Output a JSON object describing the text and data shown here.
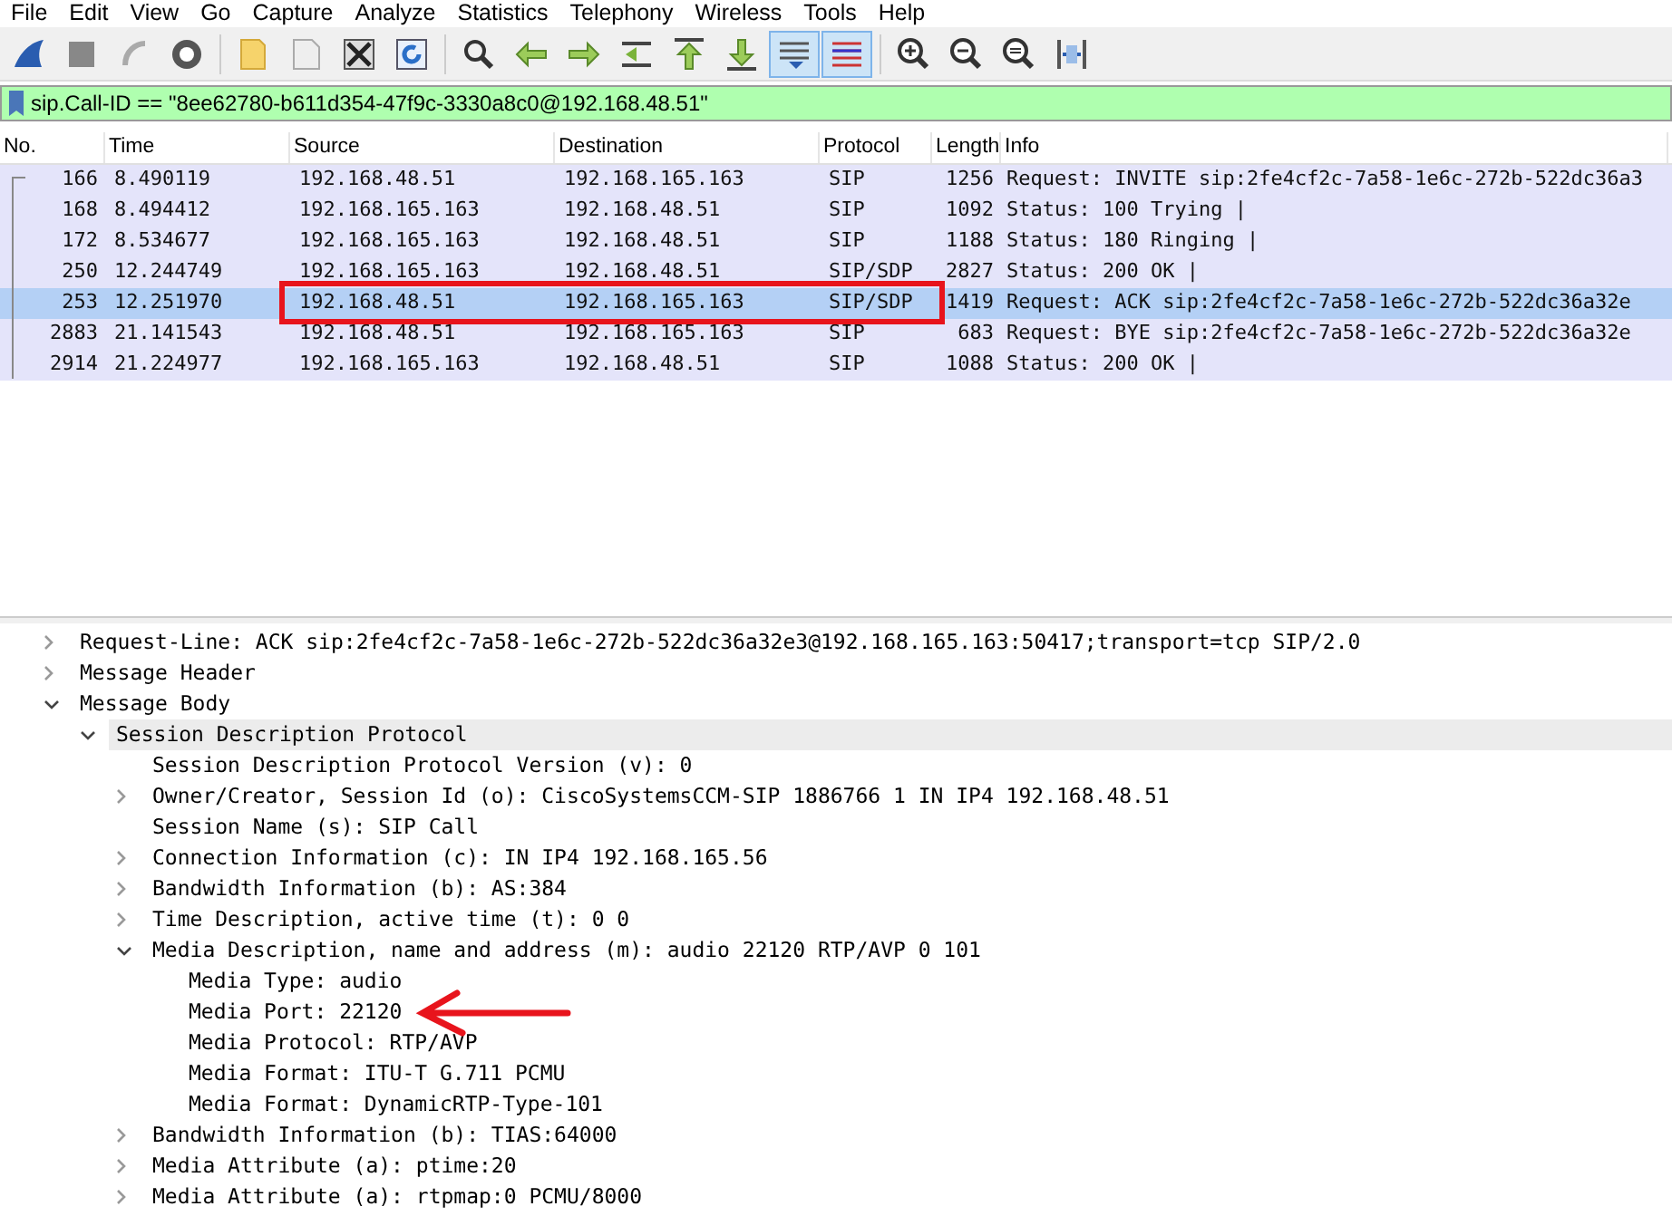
{
  "menu": [
    "File",
    "Edit",
    "View",
    "Go",
    "Capture",
    "Analyze",
    "Statistics",
    "Telephony",
    "Wireless",
    "Tools",
    "Help"
  ],
  "toolbar": [
    {
      "pressed": false
    },
    {
      "pressed": false
    },
    {
      "pressed": false
    },
    {
      "pressed": false
    },
    {
      "pressed": false
    },
    {
      "pressed": false
    },
    {
      "pressed": false
    },
    {
      "pressed": false
    },
    {
      "pressed": false
    },
    {
      "pressed": false
    },
    {
      "pressed": false
    },
    {
      "pressed": false
    },
    {
      "pressed": false
    },
    {
      "pressed": false
    },
    {
      "pressed": true
    },
    {
      "pressed": true
    },
    {
      "pressed": false
    },
    {
      "pressed": false
    },
    {
      "pressed": false
    },
    {
      "pressed": false
    }
  ],
  "filter": {
    "value": "sip.Call-ID == \"8ee62780-b611d354-47f9c-3330a8c0@192.168.48.51\""
  },
  "packet_list": {
    "columns": [
      "No.",
      "Time",
      "Source",
      "Destination",
      "Protocol",
      "Length",
      "Info"
    ],
    "rows": [
      {
        "cells": [
          "166",
          "8.490119",
          "192.168.48.51",
          "192.168.165.163",
          "SIP",
          "1256",
          "Request: INVITE sip:2fe4cf2c-7a58-1e6c-272b-522dc36a3"
        ],
        "selected": false
      },
      {
        "cells": [
          "168",
          "8.494412",
          "192.168.165.163",
          "192.168.48.51",
          "SIP",
          "1092",
          "Status: 100 Trying |"
        ],
        "selected": false
      },
      {
        "cells": [
          "172",
          "8.534677",
          "192.168.165.163",
          "192.168.48.51",
          "SIP",
          "1188",
          "Status: 180 Ringing |"
        ],
        "selected": false
      },
      {
        "cells": [
          "250",
          "12.244749",
          "192.168.165.163",
          "192.168.48.51",
          "SIP/SDP",
          "2827",
          "Status: 200 OK |"
        ],
        "selected": false
      },
      {
        "cells": [
          "253",
          "12.251970",
          "192.168.48.51",
          "192.168.165.163",
          "SIP/SDP",
          "1419",
          "Request: ACK sip:2fe4cf2c-7a58-1e6c-272b-522dc36a32e"
        ],
        "selected": true
      },
      {
        "cells": [
          "2883",
          "21.141543",
          "192.168.48.51",
          "192.168.165.163",
          "SIP",
          "683",
          "Request: BYE sip:2fe4cf2c-7a58-1e6c-272b-522dc36a32e"
        ],
        "selected": false
      },
      {
        "cells": [
          "2914",
          "21.224977",
          "192.168.165.163",
          "192.168.48.51",
          "SIP",
          "1088",
          "Status: 200 OK |"
        ],
        "selected": false
      }
    ]
  },
  "packet_details": [
    {
      "label": "Request-Line: ACK sip:2fe4cf2c-7a58-1e6c-272b-522dc36a32e3@192.168.165.163:50417;transport=tcp SIP/2.0",
      "expanded": false,
      "selected": false
    },
    {
      "label": "Message Header",
      "expanded": false,
      "selected": false
    },
    {
      "label": "Message Body",
      "expanded": true,
      "selected": false,
      "children": [
        {
          "label": "Session Description Protocol",
          "expanded": true,
          "selected": true,
          "children": [
            {
              "label": "Session Description Protocol Version (v): 0",
              "selected": false
            },
            {
              "label": "Owner/Creator, Session Id (o): CiscoSystemsCCM-SIP 1886766 1 IN IP4 192.168.48.51",
              "expanded": false,
              "selected": false
            },
            {
              "label": "Session Name (s): SIP Call",
              "selected": false
            },
            {
              "label": "Connection Information (c): IN IP4 192.168.165.56",
              "expanded": false,
              "selected": false
            },
            {
              "label": "Bandwidth Information (b): AS:384",
              "expanded": false,
              "selected": false
            },
            {
              "label": "Time Description, active time (t): 0 0",
              "expanded": false,
              "selected": false
            },
            {
              "label": "Media Description, name and address (m): audio 22120 RTP/AVP 0 101",
              "expanded": true,
              "selected": false,
              "children": [
                {
                  "label": "Media Type: audio",
                  "selected": false
                },
                {
                  "label": "Media Port: 22120",
                  "selected": false
                },
                {
                  "label": "Media Protocol: RTP/AVP",
                  "selected": false
                },
                {
                  "label": "Media Format: ITU-T G.711 PCMU",
                  "selected": false
                },
                {
                  "label": "Media Format: DynamicRTP-Type-101",
                  "selected": false
                }
              ]
            },
            {
              "label": "Bandwidth Information (b): TIAS:64000",
              "expanded": false,
              "selected": false
            },
            {
              "label": "Media Attribute (a): ptime:20",
              "expanded": false,
              "selected": false
            },
            {
              "label": "Media Attribute (a): rtpmap:0 PCMU/8000",
              "expanded": false,
              "selected": false
            }
          ]
        }
      ]
    }
  ]
}
